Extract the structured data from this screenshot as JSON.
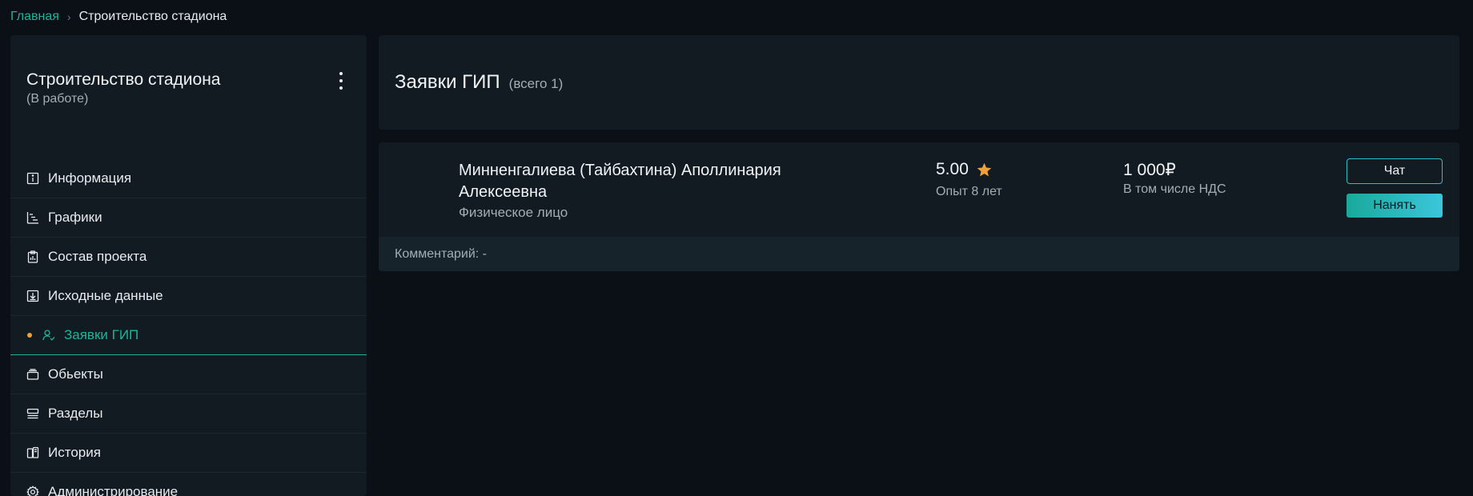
{
  "breadcrumb": {
    "home": "Главная",
    "separator": "›",
    "current": "Строительство стадиона"
  },
  "sidebar": {
    "title": "Строительство стадиона",
    "status": "(В работе)",
    "menu_icon": "kebab-menu-icon",
    "items": [
      {
        "label": "Информация",
        "icon": "info-icon"
      },
      {
        "label": "Графики",
        "icon": "gantt-icon"
      },
      {
        "label": "Состав проекта",
        "icon": "clipboard-chart-icon"
      },
      {
        "label": "Исходные данные",
        "icon": "download-box-icon"
      },
      {
        "label": "Заявки ГИП",
        "icon": "user-check-icon",
        "active": true
      },
      {
        "label": "Обьекты",
        "icon": "stack-icon"
      },
      {
        "label": "Разделы",
        "icon": "sections-icon"
      },
      {
        "label": "История",
        "icon": "history-icon"
      },
      {
        "label": "Администрирование",
        "icon": "gear-icon"
      }
    ]
  },
  "main": {
    "title": "Заявки ГИП",
    "count": "(всего 1)"
  },
  "application": {
    "name": "Минненгалиева (Тайбахтина) Аполлинария Алексеевна",
    "type": "Физическое лицо",
    "rating": "5.00",
    "rating_icon": "star-icon",
    "experience": "Опыт 8 лет",
    "price": "1 000₽",
    "vat": "В том числе НДС",
    "chat_label": "Чат",
    "hire_label": "Нанять",
    "comment": "Комментарий: -"
  },
  "colors": {
    "accent": "#1fb39a",
    "active_dot": "#f0a036",
    "star": "#f0a036",
    "background": "#0b1017",
    "panel": "#121b22"
  }
}
